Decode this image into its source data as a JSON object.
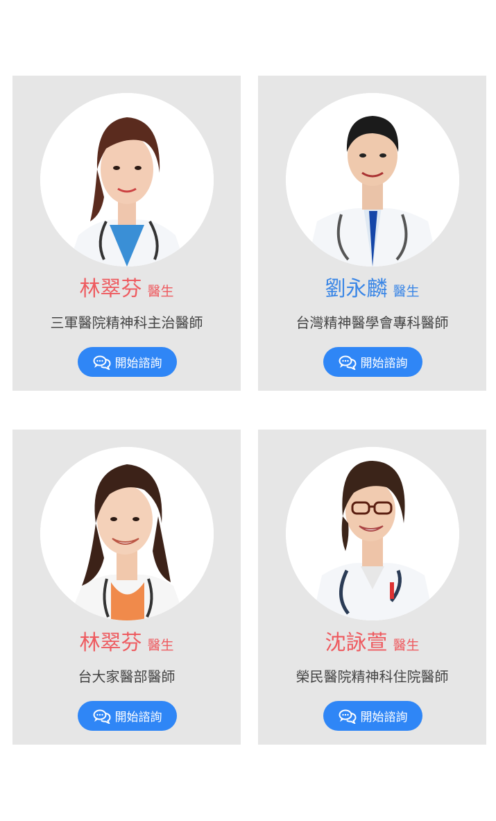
{
  "doctors": [
    {
      "name": "林翠芬",
      "title": "醫生",
      "description": "三軍醫院精神科主治醫師",
      "button_label": "開始諮詢",
      "name_color": "#ee5a5f",
      "avatar": "female-doctor-photo"
    },
    {
      "name": "劉永麟",
      "title": "醫生",
      "description": "台灣精神醫學會專科醫師",
      "button_label": "開始諮詢",
      "name_color": "#3a86e6",
      "avatar": "male-doctor-photo"
    },
    {
      "name": "林翠芬",
      "title": "醫生",
      "description": "台大家醫部醫師",
      "button_label": "開始諮詢",
      "name_color": "#ee5a5f",
      "avatar": "female-doctor-photo"
    },
    {
      "name": "沈詠萱",
      "title": "醫生",
      "description": "榮民醫院精神科住院醫師",
      "button_label": "開始諮詢",
      "name_color": "#ee5a5f",
      "avatar": "female-doctor-with-glasses-photo"
    }
  ],
  "colors": {
    "card_bg": "#e6e6e6",
    "button_bg": "#2f86f6",
    "female_accent": "#ee5a5f",
    "male_accent": "#3a86e6"
  },
  "icons": {
    "consult": "chat-bubbles-icon"
  }
}
